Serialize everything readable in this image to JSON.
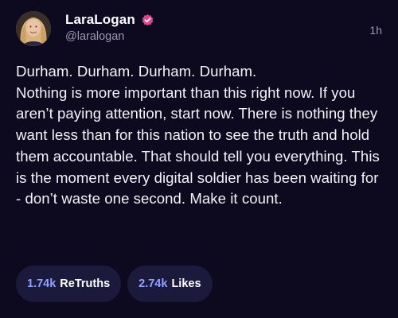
{
  "post": {
    "display_name": "LaraLogan",
    "handle": "@laralogan",
    "timestamp": "1h",
    "verified_badge": "verified-badge-icon",
    "lines": [
      "Durham. Durham. Durham. Durham.",
      "Nothing is more important than this right now. If you aren’t paying attention, start now. There is nothing they want less than for this nation to see the truth and hold them accountable. That should tell you everything. This is the moment every digital soldier has been waiting for - don’t waste one second. Make it count."
    ],
    "stats": {
      "retruths_count": "1.74k",
      "retruths_label": "ReTruths",
      "likes_count": "2.74k",
      "likes_label": "Likes"
    }
  },
  "colors": {
    "background": "#0d0a1f",
    "pill": "#1c1a3c",
    "accent": "#8fa3ff",
    "badge": "#e8408a"
  }
}
